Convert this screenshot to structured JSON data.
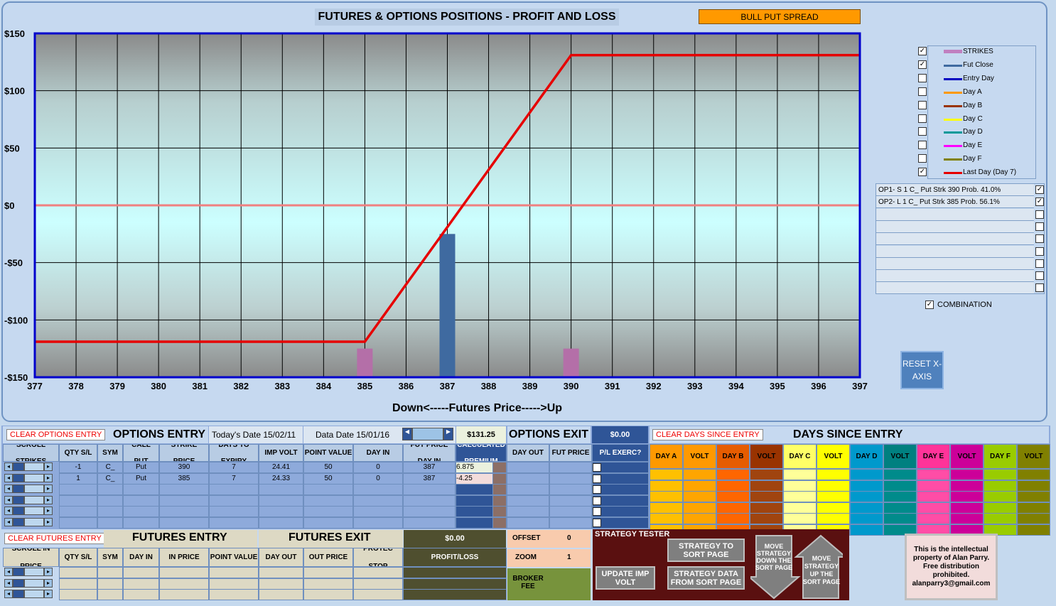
{
  "header": {
    "title": "FUTURES & OPTIONS POSITIONS - PROFIT AND LOSS",
    "strategy": "BULL PUT SPREAD"
  },
  "chart_data": {
    "type": "line",
    "xlabel": "Down<-----Futures Price----->Up",
    "ylabel": "",
    "x": [
      377,
      378,
      379,
      380,
      381,
      382,
      383,
      384,
      385,
      386,
      387,
      388,
      389,
      390,
      391,
      392,
      393,
      394,
      395,
      396,
      397
    ],
    "xlim": [
      377,
      397
    ],
    "ylim": [
      -150,
      150
    ],
    "yticks": [
      "$150",
      "$100",
      "$50",
      "$0",
      "-$50",
      "-$100",
      "-$150"
    ],
    "yvals": [
      150,
      100,
      50,
      0,
      -50,
      -100,
      -150
    ],
    "series": [
      {
        "name": "Last Day (Day 7)",
        "color": "#e60000",
        "points": [
          [
            377,
            -119
          ],
          [
            385,
            -119
          ],
          [
            390,
            131
          ],
          [
            397,
            131
          ]
        ]
      }
    ],
    "zero_line_color": "#f08080",
    "bars": [
      {
        "name": "STRIKES",
        "x": 385,
        "y": -125,
        "color": "#b46fa8"
      },
      {
        "name": "Fut Close",
        "x": 387,
        "y": -25,
        "color": "#3f6aa0"
      },
      {
        "name": "STRIKES",
        "x": 390,
        "y": -125,
        "color": "#b46fa8"
      }
    ]
  },
  "legend": {
    "items": [
      {
        "label": "STRIKES",
        "checked": true,
        "color": "#c080c0"
      },
      {
        "label": "Fut Close",
        "checked": true,
        "color": "#3f6aa0"
      },
      {
        "label": "Entry Day",
        "checked": false,
        "color": "#0000c0"
      },
      {
        "label": "Day A",
        "checked": false,
        "color": "#ff9900"
      },
      {
        "label": "Day B",
        "checked": false,
        "color": "#993300"
      },
      {
        "label": "Day C",
        "checked": false,
        "color": "#ffff00"
      },
      {
        "label": "Day D",
        "checked": false,
        "color": "#009999"
      },
      {
        "label": "Day E",
        "checked": false,
        "color": "#ff00ff"
      },
      {
        "label": "Day F",
        "checked": false,
        "color": "#808000"
      },
      {
        "label": "Last Day (Day 7)",
        "checked": true,
        "color": "#e60000"
      }
    ],
    "options": [
      "OP1- S 1 C_ Put Strk 390 Prob. 41.0%",
      "OP2- L 1 C_ Put Strk 385 Prob. 56.1%",
      "",
      "",
      "",
      "",
      "",
      "",
      ""
    ],
    "combination": "COMBINATION",
    "reset": "RESET X-AXIS"
  },
  "options_entry": {
    "clear": "CLEAR OPTIONS ENTRY",
    "title": "OPTIONS ENTRY",
    "today": "Today's Date 15/02/11",
    "datadate": "Data Date 15/01/16",
    "premium": "$131.25",
    "headers": [
      "SCROLL STRIKES",
      "QTY S/L",
      "SYM",
      "CALL PUT",
      "STRIKE PRICE",
      "DAYS TO EXPIRY",
      "IMP VOLT",
      "POINT VALUE",
      "DAY IN",
      "FUT PRICE DAY IN",
      "CALCULATED PREMIUM"
    ],
    "rows": [
      [
        "-1",
        "C_",
        "Put",
        "390",
        "7",
        "24.41",
        "50",
        "0",
        "387",
        "6.875"
      ],
      [
        "1",
        "C_",
        "Put",
        "385",
        "7",
        "24.33",
        "50",
        "0",
        "387",
        "-4.25"
      ]
    ]
  },
  "options_exit": {
    "title": "OPTIONS EXIT",
    "headers": [
      "DAY OUT",
      "FUT PRICE"
    ],
    "pl": "$0.00",
    "pl_label": "P/L EXERC?"
  },
  "days": {
    "clear": "CLEAR DAYS SINCE ENTRY",
    "title": "DAYS SINCE ENTRY",
    "headers": [
      "DAY A",
      "VOLT",
      "DAY B",
      "VOLT",
      "DAY C",
      "VOLT",
      "DAY D",
      "VOLT",
      "DAY E",
      "VOLT",
      "DAY F",
      "VOLT"
    ],
    "colors": [
      "#ff9900",
      "#ff9900",
      "#e65c00",
      "#993300",
      "#ffff66",
      "#ffff00",
      "#0099cc",
      "#008080",
      "#ff3399",
      "#cc0099",
      "#99cc00",
      "#808000"
    ],
    "cellcolors": [
      "#ffc000",
      "#ffa500",
      "#ff6600",
      "#a0440f",
      "#ffff99",
      "#ffff00",
      "#0099cc",
      "#008b8b",
      "#ff4da6",
      "#cc0099",
      "#99cc00",
      "#808000"
    ]
  },
  "futures_entry": {
    "clear": "CLEAR FUTURES ENTRY",
    "title": "FUTURES ENTRY",
    "headers": [
      "SCROLL IN PRICE",
      "QTY S/L",
      "SYM",
      "DAY IN",
      "IN PRICE",
      "POINT VALUE"
    ]
  },
  "futures_exit": {
    "title": "FUTURES EXIT",
    "headers": [
      "DAY OUT",
      "OUT PRICE",
      "PROTEC STOP"
    ],
    "pl": "$0.00",
    "pl_label": "PROFIT/LOSS"
  },
  "offset": {
    "label": "OFFSET",
    "value": "0"
  },
  "zoom": {
    "label": "ZOOM",
    "value": "1"
  },
  "broker": "BROKER FEE",
  "tester": {
    "title": "STRATEGY TESTER",
    "to_sort": "STRATEGY TO SORT PAGE",
    "from_sort": "STRATEGY DATA FROM SORT PAGE",
    "update": "UPDATE IMP VOLT",
    "down": "MOVE STRATEGY DOWN THE SORT PAGE",
    "up": "MOVE STRATEGY UP THE SORT PAGE"
  },
  "notice": "This is the intellectual property of Alan Parry. Free distribution prohibited. alanparry3@gmail.com"
}
